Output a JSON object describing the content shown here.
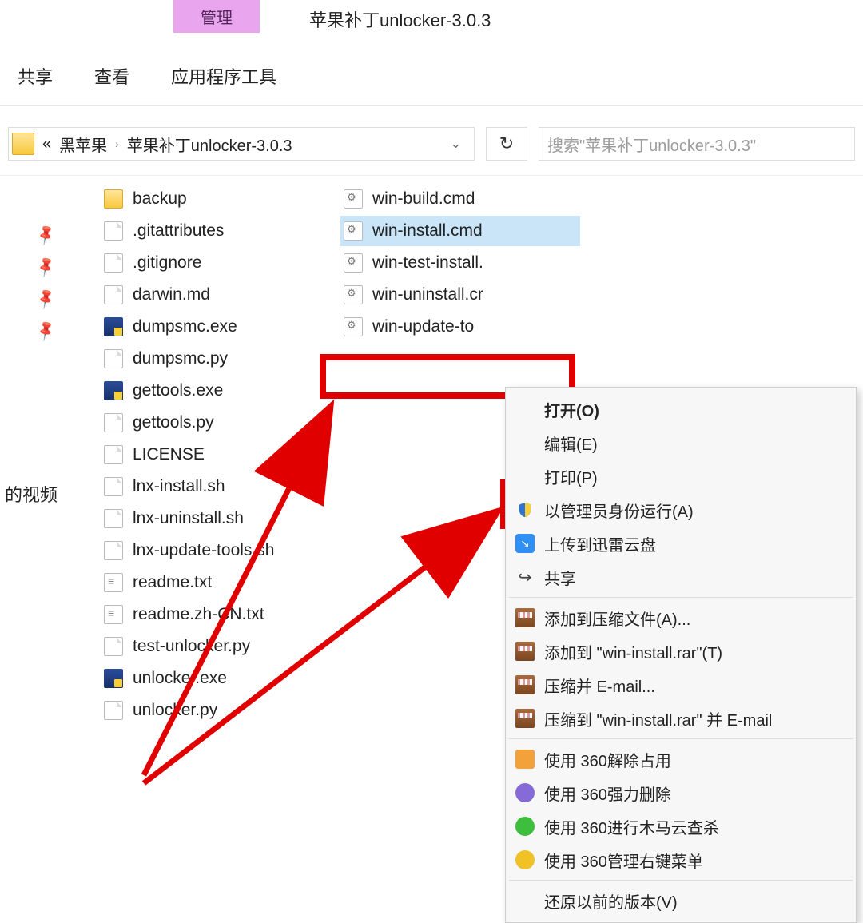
{
  "ribbon": {
    "highlight_tab": "管理",
    "tabs": [
      "共享",
      "查看",
      "应用程序工具"
    ]
  },
  "window": {
    "title": "苹果补丁unlocker-3.0.3"
  },
  "address": {
    "overflow": "«",
    "crumb1": "黑苹果",
    "crumb2": "苹果补丁unlocker-3.0.3"
  },
  "search": {
    "placeholder": "搜索\"苹果补丁unlocker-3.0.3\""
  },
  "sidebar": {
    "video_label": "的视频"
  },
  "files_col1": [
    {
      "icon": "folder",
      "name": "backup"
    },
    {
      "icon": "file",
      "name": ".gitattributes"
    },
    {
      "icon": "file",
      "name": ".gitignore"
    },
    {
      "icon": "file",
      "name": "darwin.md"
    },
    {
      "icon": "exe",
      "name": "dumpsmc.exe"
    },
    {
      "icon": "file",
      "name": "dumpsmc.py"
    },
    {
      "icon": "exe",
      "name": "gettools.exe"
    },
    {
      "icon": "file",
      "name": "gettools.py"
    },
    {
      "icon": "file",
      "name": "LICENSE"
    },
    {
      "icon": "file",
      "name": "lnx-install.sh"
    },
    {
      "icon": "file",
      "name": "lnx-uninstall.sh"
    },
    {
      "icon": "file",
      "name": "lnx-update-tools.sh"
    },
    {
      "icon": "txt",
      "name": "readme.txt"
    },
    {
      "icon": "txt",
      "name": "readme.zh-CN.txt"
    },
    {
      "icon": "file",
      "name": "test-unlocker.py"
    },
    {
      "icon": "exe",
      "name": "unlocker.exe"
    },
    {
      "icon": "file",
      "name": "unlocker.py"
    }
  ],
  "files_col2": [
    {
      "icon": "cmd",
      "name": "win-build.cmd",
      "selected": false
    },
    {
      "icon": "cmd",
      "name": "win-install.cmd",
      "selected": true
    },
    {
      "icon": "cmd",
      "name": "win-test-install.",
      "selected": false
    },
    {
      "icon": "cmd",
      "name": "win-uninstall.cr",
      "selected": false
    },
    {
      "icon": "cmd",
      "name": "win-update-to",
      "selected": false
    }
  ],
  "context_menu": {
    "items": [
      {
        "icon": "none",
        "label": "打开(O)",
        "bold": true
      },
      {
        "icon": "none",
        "label": "编辑(E)"
      },
      {
        "icon": "none",
        "label": "打印(P)"
      },
      {
        "icon": "shield",
        "label": "以管理员身份运行(A)"
      },
      {
        "icon": "xl",
        "label": "上传到迅雷云盘"
      },
      {
        "icon": "share",
        "label": "共享"
      },
      {
        "sep": true
      },
      {
        "icon": "rar",
        "label": "添加到压缩文件(A)..."
      },
      {
        "icon": "rar",
        "label": "添加到 \"win-install.rar\"(T)"
      },
      {
        "icon": "rar",
        "label": "压缩并 E-mail..."
      },
      {
        "icon": "rar",
        "label": "压缩到 \"win-install.rar\" 并 E-mail"
      },
      {
        "sep": true
      },
      {
        "icon": "360a",
        "label": "使用 360解除占用"
      },
      {
        "icon": "360b",
        "label": "使用 360强力删除"
      },
      {
        "icon": "360c",
        "label": "使用 360进行木马云查杀"
      },
      {
        "icon": "360d",
        "label": "使用 360管理右键菜单"
      },
      {
        "sep": true
      },
      {
        "icon": "none",
        "label": "还原以前的版本(V)"
      }
    ]
  }
}
